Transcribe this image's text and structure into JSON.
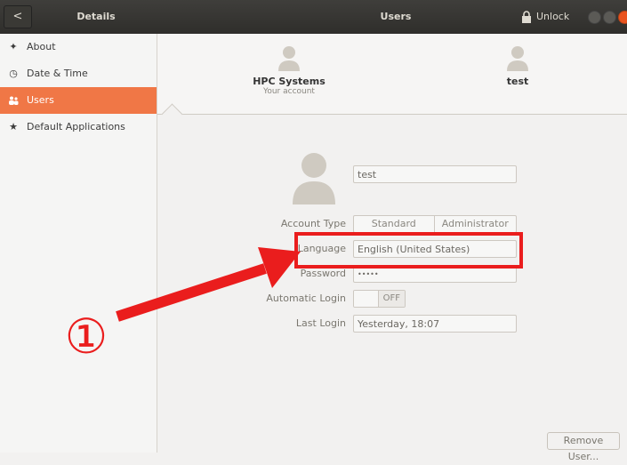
{
  "titlebar": {
    "back_glyph": "<",
    "left_title": "Details",
    "center_title": "Users",
    "unlock_label": "Unlock"
  },
  "sidebar": {
    "items": [
      {
        "label": "About",
        "icon": "star4-icon"
      },
      {
        "label": "Date & Time",
        "icon": "clock-icon"
      },
      {
        "label": "Users",
        "icon": "users-icon",
        "active": true
      },
      {
        "label": "Default Applications",
        "icon": "star-icon"
      }
    ]
  },
  "users_strip": {
    "users": [
      {
        "name": "HPC Systems",
        "subtitle": "Your account"
      },
      {
        "name": "test",
        "subtitle": ""
      }
    ]
  },
  "details": {
    "name_value": "test",
    "account_type_label": "Account Type",
    "account_type_options": [
      "Standard",
      "Administrator"
    ],
    "language_label": "Language",
    "language_value": "English (United States)",
    "password_label": "Password",
    "password_value": "•••••",
    "auto_login_label": "Automatic Login",
    "auto_login_state": "OFF",
    "last_login_label": "Last Login",
    "last_login_value": "Yesterday, 18:07",
    "remove_button": "Remove User..."
  },
  "annotation": {
    "step_number": "①",
    "color": "#ea1d1d"
  },
  "colors": {
    "accent": "#f07746",
    "titlebar": "#2f2e2b",
    "close_button": "#e9541f"
  }
}
